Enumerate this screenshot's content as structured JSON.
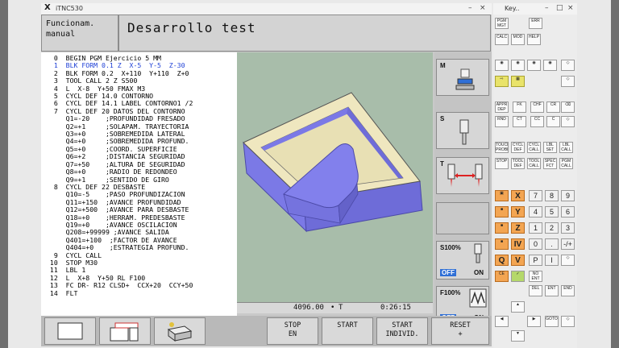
{
  "window": {
    "title": "iTNC530",
    "title2": "Key..",
    "controls": [
      "–",
      "□",
      "×"
    ]
  },
  "header": {
    "mode_left": "Funcionam. manual",
    "mode_left_lines": [
      "Funcionam.",
      "manual"
    ],
    "mode_right": "Desarrollo test"
  },
  "program": {
    "lines": [
      "  0  BEGIN PGM Ejercicio 5 MM",
      "  1  BLK FORM 0.1 Z  X-5  Y-5  Z-30",
      "  2  BLK FORM 0.2  X+110  Y+110  Z+0",
      "  3  TOOL CALL 2 Z S500",
      "  4  L  X-8  Y+50 FMAX M3",
      "  5  CYCL DEF 14.0 CONTORNO",
      "  6  CYCL DEF 14.1 LABEL CONTORNO1 /2",
      "  7  CYCL DEF 20 DATOS DEL CONTORNO",
      "     Q1=-20    ;PROFUNDIDAD FRESADO",
      "     Q2=+1     ;SOLAPAM. TRAYECTORIA",
      "     Q3=+0     ;SOBREMEDIDA LATERAL",
      "     Q4=+0     ;SOBREMEDIDA PROFUND.",
      "     Q5=+0     ;COORD. SUPERFICIE",
      "     Q6=+2     ;DISTANCIA SEGURIDAD",
      "     Q7=+50    ;ALTURA DE SEGURIDAD",
      "     Q8=+0     ;RADIO DE REDONDEO",
      "     Q9=+1     ;SENTIDO DE GIRO",
      "  8  CYCL DEF 22 DESBASTE",
      "     Q10=-5    ;PASO PROFUNDIZACION",
      "     Q11=+150  ;AVANCE PROFUNDIDAD",
      "     Q12=+500  ;AVANCE PARA DESBASTE",
      "     Q18=+0    ;HERRAM. PREDESBASTE",
      "     Q19=+0    ;AVANCE OSCILACION",
      "     Q208=+99999 ;AVANCE SALIDA",
      "     Q401=+100  ;FACTOR DE AVANCE",
      "     Q404=+0    ;ESTRATEGIA PROFUND.",
      "  9  CYCL CALL",
      " 10  STOP M30",
      " 11  LBL 1",
      " 12  L  X+8  Y+50 RL F100",
      " 13  FC DR- R12 CLSD+  CCX+20  CCY+50",
      " 14  FLT"
    ],
    "highlight_index": 1
  },
  "status": {
    "value1": "4096.00",
    "sep": "•",
    "mark": "T",
    "time": "0:26:15"
  },
  "right_panels": {
    "m": "M",
    "s": "S",
    "t": "T",
    "s_override": "S100%",
    "f_override": "F100%",
    "off": "OFF",
    "on": "ON"
  },
  "softkeys": [
    {
      "label": ""
    },
    {
      "label": ""
    },
    {
      "label": ""
    },
    {
      "label": "STOP\nEN"
    },
    {
      "label": "START"
    },
    {
      "label": "START\nINDIVID."
    },
    {
      "label": "RESET\n+"
    }
  ],
  "keypad": {
    "top": [
      "PGM MGT",
      "ERR",
      "CALC",
      "MOD",
      "HELP"
    ],
    "middle": [
      "APPR DEP",
      "FK",
      "CHF",
      "CR",
      "RND",
      "CT",
      "CC",
      "C",
      "TOUCH PROBE",
      "CYCL DEF",
      "CYCL CALL",
      "LBL SET",
      "LBL CALL",
      "STOP",
      "TOOL DEF",
      "TOOL CALL",
      "SPEC FCT",
      "PGM CALL"
    ],
    "axes": [
      "X",
      "Y",
      "Z",
      "IV",
      "V"
    ],
    "digits": [
      "7",
      "8",
      "9",
      "4",
      "5",
      "6",
      "1",
      "2",
      "3",
      "0",
      ".",
      "-/+"
    ],
    "special": [
      "Q",
      "P",
      "I",
      "CE",
      "NO ENT",
      "ENT",
      "DEL",
      "END",
      "GOTO"
    ],
    "colors": {
      "orange": "#f3a552",
      "yellow": "#e9e36a",
      "screen_bg": "#a8bdaa",
      "highlight": "#1d3fd6"
    }
  }
}
